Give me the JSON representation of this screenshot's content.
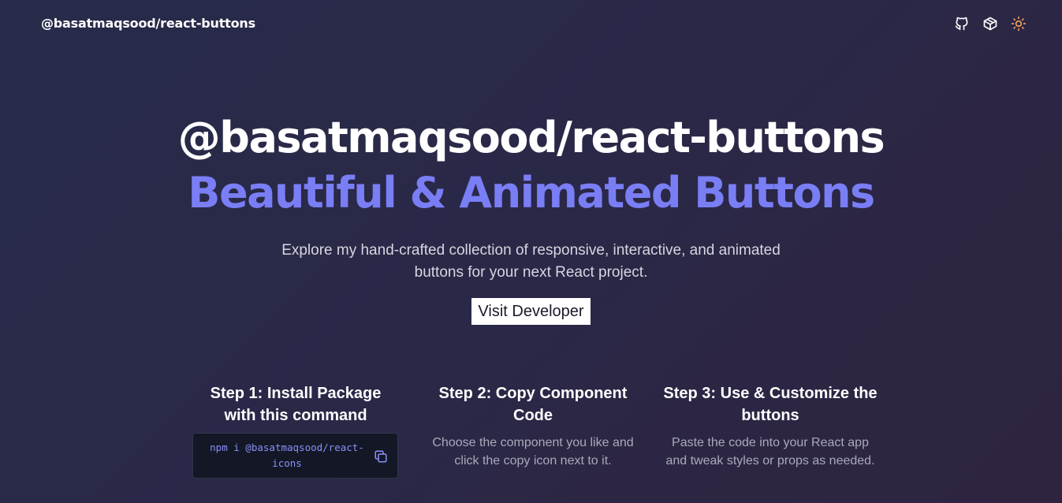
{
  "navbar": {
    "brand": "@basatmaqsood/react-buttons",
    "icons": [
      "github-icon",
      "package-icon",
      "sun-icon"
    ]
  },
  "hero": {
    "title": "@basatmaqsood/react-buttons",
    "subtitle": "Beautiful & Animated Buttons",
    "description": "Explore my hand-crafted collection of responsive, interactive, and animated buttons for your next React project.",
    "cta_label": "Visit Developer"
  },
  "steps": [
    {
      "title": "Step 1: Install Package with this command",
      "code": "npm i @basatmaqsood/react-icons"
    },
    {
      "title": "Step 2: Copy Component Code",
      "description": "Choose the component you like and click the copy icon next to it."
    },
    {
      "title": "Step 3: Use & Customize the buttons",
      "description": "Paste the code into your React app and tweak styles or props as needed."
    }
  ],
  "colors": {
    "accent": "#7a7ef5",
    "sun_icon": "#f3a15a",
    "code_text": "#8b8ff8"
  }
}
